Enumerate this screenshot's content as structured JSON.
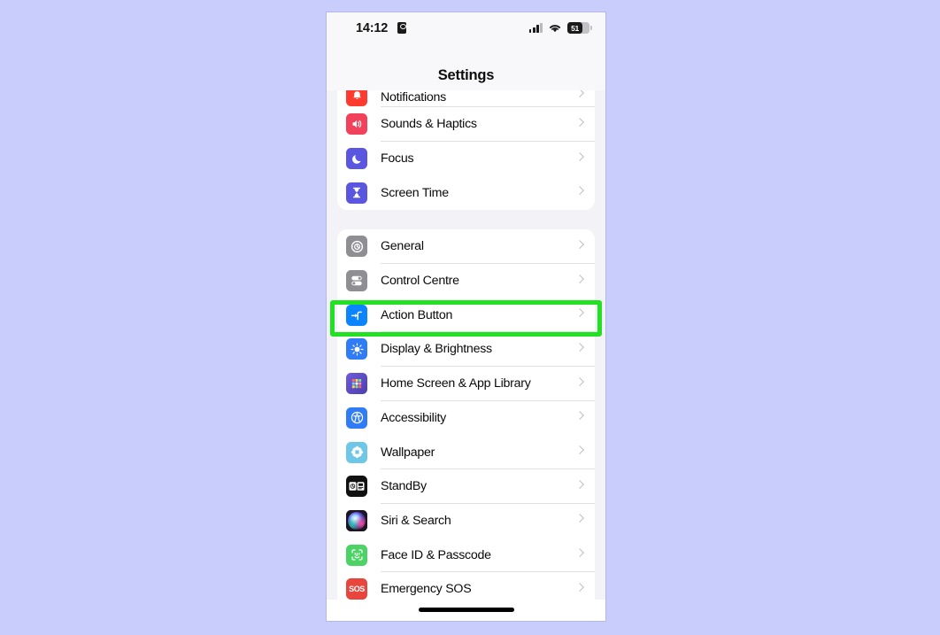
{
  "background_color": "#c9cdfb",
  "status_bar": {
    "time": "14:12",
    "time_badge_icon": "lock-portrait-icon",
    "cellular_icon": "cellular-signal-icon",
    "wifi_icon": "wifi-icon",
    "battery_icon": "battery-icon",
    "battery_level": "51"
  },
  "nav": {
    "title": "Settings"
  },
  "highlight": {
    "color": "#22e022",
    "target_row": "Action Button"
  },
  "groups": [
    {
      "id": "group-notifications",
      "rows": [
        {
          "label": "Notifications",
          "icon": "bell-icon",
          "icon_color": "#ff3b30",
          "clipped": true
        },
        {
          "label": "Sounds & Haptics",
          "icon": "speaker-waves-icon",
          "icon_color": "#f2415a",
          "clipped": false
        },
        {
          "label": "Focus",
          "icon": "moon-icon",
          "icon_color": "#5a56e0",
          "clipped": false
        },
        {
          "label": "Screen Time",
          "icon": "hourglass-icon",
          "icon_color": "#5a56e0",
          "clipped": false
        }
      ]
    },
    {
      "id": "group-system",
      "rows": [
        {
          "label": "General",
          "icon": "gear-icon",
          "icon_color": "#8e8e93",
          "clipped": false
        },
        {
          "label": "Control Centre",
          "icon": "toggles-icon",
          "icon_color": "#8e8e93",
          "clipped": false
        },
        {
          "label": "Action Button",
          "icon": "action-button-icon",
          "icon_color": "#0a84ff",
          "clipped": false
        },
        {
          "label": "Display & Brightness",
          "icon": "brightness-sun-icon",
          "icon_color": "#2f7cf6",
          "clipped": false
        },
        {
          "label": "Home Screen & App Library",
          "icon": "app-grid-icon",
          "icon_color": "#5b4ecf",
          "clipped": false
        },
        {
          "label": "Accessibility",
          "icon": "accessibility-icon",
          "icon_color": "#2f7cf6",
          "clipped": false
        },
        {
          "label": "Wallpaper",
          "icon": "flower-icon",
          "icon_color": "#6fc7e8",
          "clipped": false
        },
        {
          "label": "StandBy",
          "icon": "standby-widgets-icon",
          "icon_color": "#111111",
          "clipped": false
        },
        {
          "label": "Siri & Search",
          "icon": "siri-orb-icon",
          "icon_color": "#1c1524",
          "clipped": false
        },
        {
          "label": "Face ID & Passcode",
          "icon": "face-id-icon",
          "icon_color": "#4cd265",
          "clipped": false
        },
        {
          "label": "Emergency SOS",
          "icon": "sos-icon",
          "icon_color": "#e8453c",
          "clipped": false
        }
      ]
    }
  ],
  "home_indicator": "home-indicator"
}
